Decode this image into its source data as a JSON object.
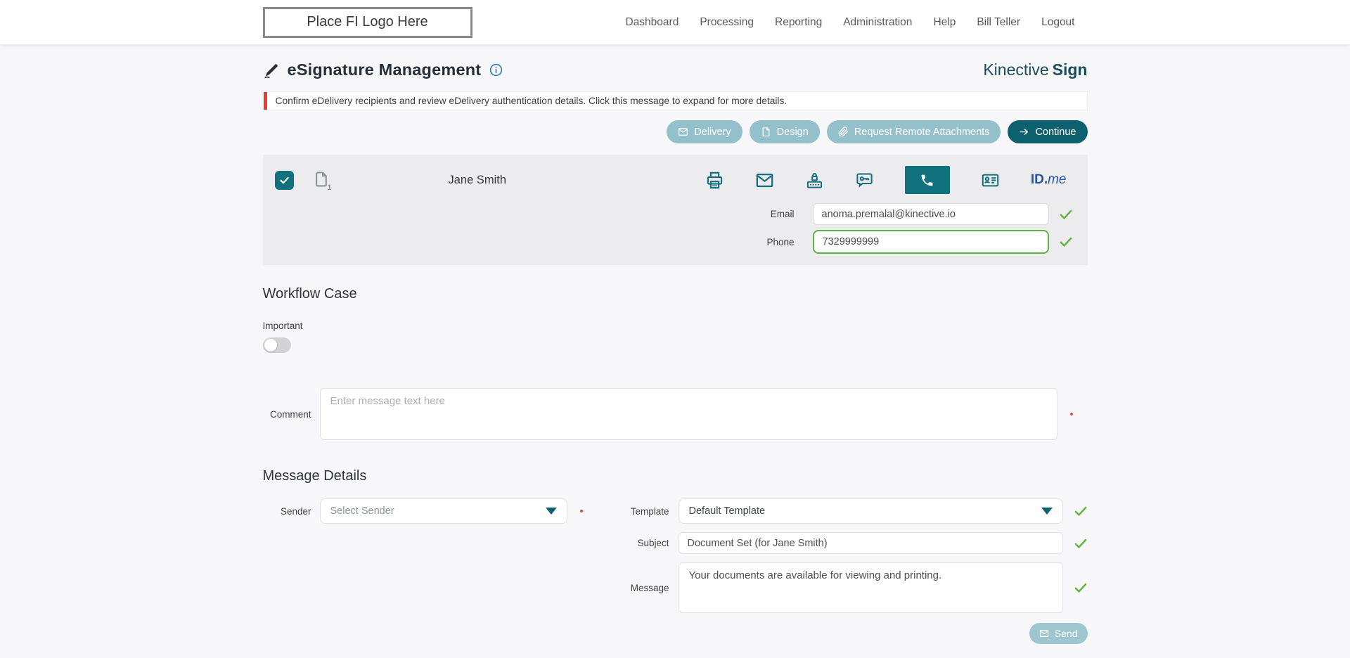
{
  "header": {
    "logo_text": "Place FI Logo Here",
    "nav": [
      "Dashboard",
      "Processing",
      "Reporting",
      "Administration",
      "Help",
      "Bill Teller",
      "Logout"
    ]
  },
  "page": {
    "title": "eSignature Management",
    "brand_name": "Kinective",
    "brand_product": "Sign",
    "alert_text": "Confirm eDelivery recipients and review eDelivery authentication details. Click this message to expand for more details.",
    "actions": {
      "delivery": "Delivery",
      "design": "Design",
      "request_remote_attachments": "Request Remote Attachments",
      "continue": "Continue"
    }
  },
  "recipient": {
    "name": "Jane Smith",
    "document_count": "1",
    "email_label": "Email",
    "email_value": "anoma.premalal@kinective.io",
    "phone_label": "Phone",
    "phone_value": "7329999999",
    "idme_brand": "ID.",
    "idme_suffix": "me"
  },
  "workflow_case": {
    "heading": "Workflow Case",
    "important_label": "Important",
    "comment_label": "Comment",
    "comment_placeholder": "Enter message text here"
  },
  "message_details": {
    "heading": "Message Details",
    "sender_label": "Sender",
    "sender_placeholder": "Select Sender",
    "template_label": "Template",
    "template_value": "Default Template",
    "subject_label": "Subject",
    "subject_value": "Document Set (for Jane Smith)",
    "message_label": "Message",
    "message_value": "Your documents are available for viewing and printing.",
    "send_label": "Send"
  },
  "colors": {
    "teal_dark": "#0d616f",
    "teal_light": "#93c0ca",
    "teal_icon": "#166f7e",
    "green_valid": "#62b53f",
    "alert_red": "#e23b3b",
    "idme_blue": "#2553a8",
    "page_bg": "#f7f7f9",
    "card_bg": "#ececee"
  }
}
